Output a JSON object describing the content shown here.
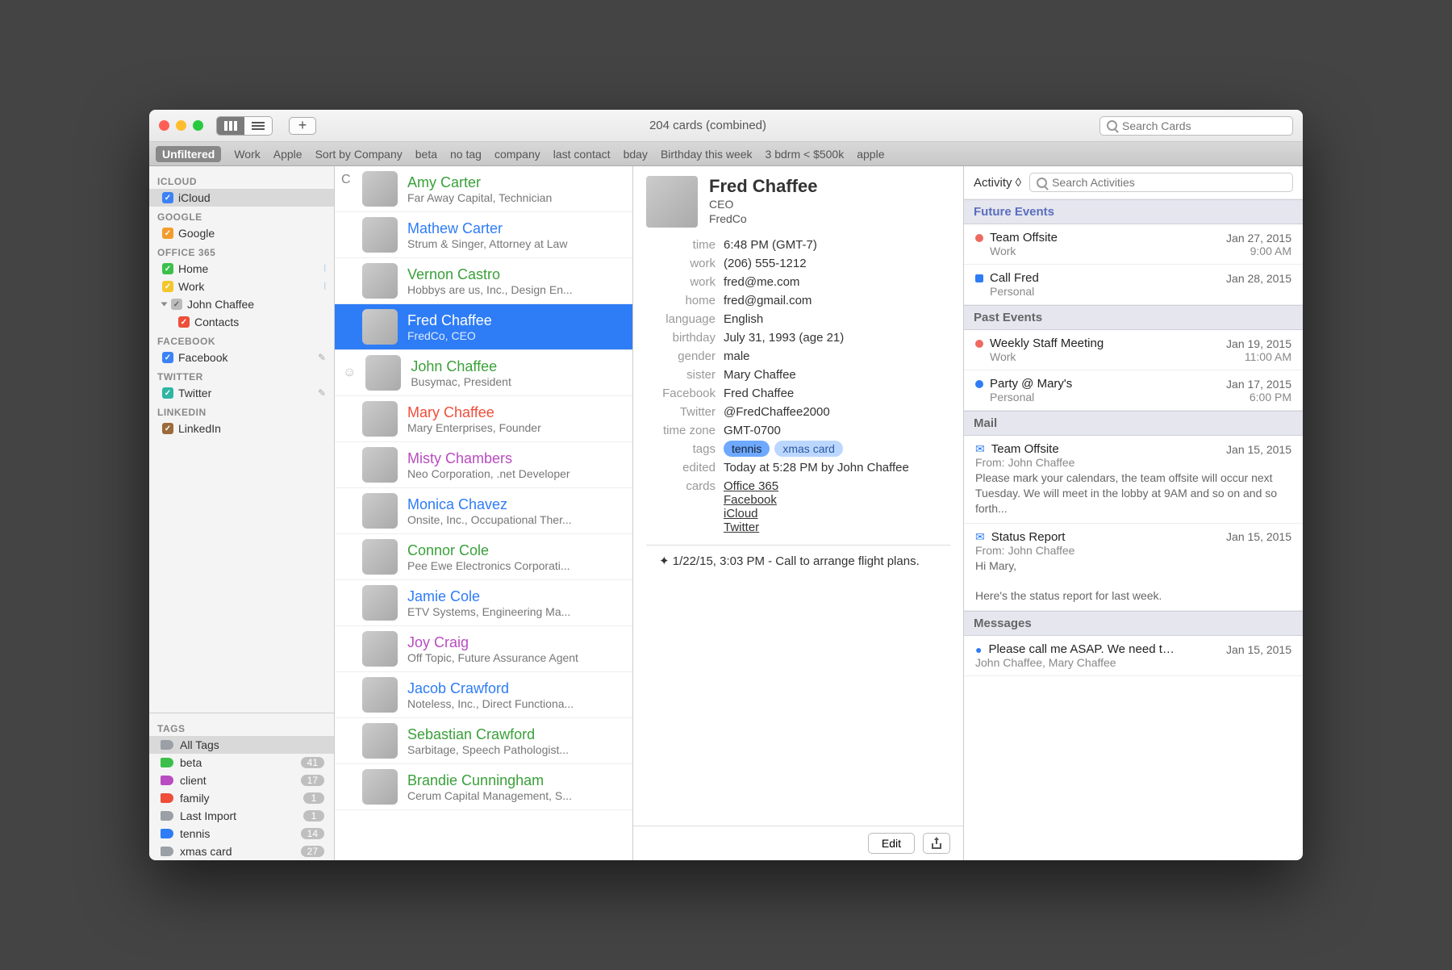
{
  "titlebar": {
    "title": "204 cards (combined)",
    "search_placeholder": "Search Cards",
    "add": "+"
  },
  "filters": [
    "Unfiltered",
    "Work",
    "Apple",
    "Sort by Company",
    "beta",
    "no tag",
    "company",
    "last contact",
    "bday",
    "Birthday this week",
    "3 bdrm < $500k",
    "apple"
  ],
  "sidebar": {
    "groups": [
      {
        "head": "ICLOUD",
        "items": [
          {
            "label": "iCloud",
            "color": "blue",
            "sel": true
          }
        ]
      },
      {
        "head": "GOOGLE",
        "items": [
          {
            "label": "Google",
            "color": "orange"
          }
        ]
      },
      {
        "head": "OFFICE 365",
        "items": [
          {
            "label": "Home",
            "color": "green",
            "wifi": true
          },
          {
            "label": "Work",
            "color": "yellow",
            "wifi": true
          },
          {
            "label": "John Chaffee",
            "color": "gray",
            "disc": true
          },
          {
            "label": "Contacts",
            "color": "red",
            "child": true
          }
        ]
      },
      {
        "head": "FACEBOOK",
        "items": [
          {
            "label": "Facebook",
            "color": "blue",
            "pencil": true
          }
        ]
      },
      {
        "head": "TWITTER",
        "items": [
          {
            "label": "Twitter",
            "color": "teal",
            "pencil": true
          }
        ]
      },
      {
        "head": "LINKEDIN",
        "items": [
          {
            "label": "LinkedIn",
            "color": "brown"
          }
        ]
      }
    ],
    "tags_head": "TAGS",
    "tags": [
      {
        "label": "All Tags",
        "color": "#9aa0a6",
        "count": "",
        "sel": true
      },
      {
        "label": "beta",
        "color": "#3cc04b",
        "count": "41"
      },
      {
        "label": "client",
        "color": "#b84cc0",
        "count": "17"
      },
      {
        "label": "family",
        "color": "#ee4e3a",
        "count": "1"
      },
      {
        "label": "Last Import",
        "color": "#9aa0a6",
        "count": "1"
      },
      {
        "label": "tennis",
        "color": "#2e7cf6",
        "count": "14"
      },
      {
        "label": "xmas card",
        "color": "#9aa0a6",
        "count": "27"
      }
    ]
  },
  "section_letter": "C",
  "contacts": [
    {
      "name": "Amy Carter",
      "sub": "Far Away Capital, Technician",
      "color": "green"
    },
    {
      "name": "Mathew Carter",
      "sub": "Strum & Singer, Attorney at Law",
      "color": "blue"
    },
    {
      "name": "Vernon Castro",
      "sub": "Hobbys are us, Inc., Design En...",
      "color": "green"
    },
    {
      "name": "Fred Chaffee",
      "sub": "FredCo, CEO",
      "color": "",
      "sel": true
    },
    {
      "name": "John Chaffee",
      "sub": "Busymac, President",
      "color": "green",
      "smiley": true
    },
    {
      "name": "Mary Chaffee",
      "sub": "Mary Enterprises, Founder",
      "color": "red"
    },
    {
      "name": "Misty Chambers",
      "sub": "Neo Corporation, .net Developer",
      "color": "purple"
    },
    {
      "name": "Monica Chavez",
      "sub": "Onsite, Inc., Occupational Ther...",
      "color": "blue"
    },
    {
      "name": "Connor Cole",
      "sub": "Pee Ewe Electronics Corporati...",
      "color": "green"
    },
    {
      "name": "Jamie Cole",
      "sub": "ETV Systems, Engineering Ma...",
      "color": "blue"
    },
    {
      "name": "Joy Craig",
      "sub": "Off Topic, Future Assurance Agent",
      "color": "purple"
    },
    {
      "name": "Jacob Crawford",
      "sub": "Noteless, Inc., Direct Functiona...",
      "color": "blue"
    },
    {
      "name": "Sebastian Crawford",
      "sub": "Sarbitage, Speech Pathologist...",
      "color": "green"
    },
    {
      "name": "Brandie Cunningham",
      "sub": "Cerum Capital Management, S...",
      "color": "green"
    }
  ],
  "detail": {
    "name": "Fred Chaffee",
    "role": "CEO",
    "company": "FredCo",
    "fields": [
      {
        "k": "time",
        "v": "6:48 PM (GMT-7)"
      },
      {
        "k": "work",
        "v": "(206) 555-1212"
      },
      {
        "k": "work",
        "v": "fred@me.com"
      },
      {
        "k": "home",
        "v": "fred@gmail.com"
      },
      {
        "k": "language",
        "v": "English"
      },
      {
        "k": "birthday",
        "v": "July 31, 1993 (age 21)"
      },
      {
        "k": "gender",
        "v": "male"
      },
      {
        "k": "sister",
        "v": "Mary Chaffee"
      },
      {
        "k": "Facebook",
        "v": "Fred Chaffee"
      },
      {
        "k": "Twitter",
        "v": "@FredChaffee2000"
      },
      {
        "k": "time zone",
        "v": "GMT-0700"
      }
    ],
    "tags_label": "tags",
    "tags": [
      "tennis",
      "xmas card"
    ],
    "edited_k": "edited",
    "edited_v": "Today at 5:28 PM by John Chaffee",
    "cards_k": "cards",
    "cards": [
      "Office 365",
      "Facebook",
      "iCloud",
      "Twitter"
    ],
    "note": "✦ 1/22/15, 3:03 PM - Call to arrange flight plans.",
    "edit": "Edit"
  },
  "activity": {
    "sort": "Activity ◊",
    "search_placeholder": "Search Activities",
    "sections": [
      {
        "head": "Future Events",
        "cls": "future",
        "items": [
          {
            "dot": "#ee6a5f",
            "shape": "circle",
            "title": "Team Offsite",
            "date": "Jan 27, 2015",
            "sub1": "Work",
            "sub2": "9:00 AM"
          },
          {
            "dot": "#2e7cf6",
            "shape": "sq",
            "title": "Call Fred",
            "date": "Jan 28, 2015",
            "sub1": "Personal",
            "sub2": ""
          }
        ]
      },
      {
        "head": "Past Events",
        "items": [
          {
            "dot": "#ee6a5f",
            "shape": "circle",
            "title": "Weekly Staff Meeting",
            "date": "Jan 19, 2015",
            "sub1": "Work",
            "sub2": "11:00 AM"
          },
          {
            "dot": "#2e7cf6",
            "shape": "circle",
            "title": "Party @ Mary's",
            "date": "Jan 17, 2015",
            "sub1": "Personal",
            "sub2": "6:00 PM"
          }
        ]
      },
      {
        "head": "Mail",
        "items": [
          {
            "icon": "mail",
            "title": "Team Offsite",
            "date": "Jan 15, 2015",
            "from": "From: John Chaffee",
            "body": "Please mark your calendars, the team offsite will occur next Tuesday. We will meet in the lobby at 9AM and so on and so forth..."
          },
          {
            "icon": "mail",
            "title": "Status Report",
            "date": "Jan 15, 2015",
            "from": "From: John Chaffee",
            "body": "Hi Mary,\n\nHere's the status report for last week."
          }
        ]
      },
      {
        "head": "Messages",
        "items": [
          {
            "icon": "msg",
            "title": "Please call me ASAP. We need t…",
            "date": "Jan 15, 2015",
            "from": "John Chaffee, Mary Chaffee"
          }
        ]
      }
    ]
  }
}
